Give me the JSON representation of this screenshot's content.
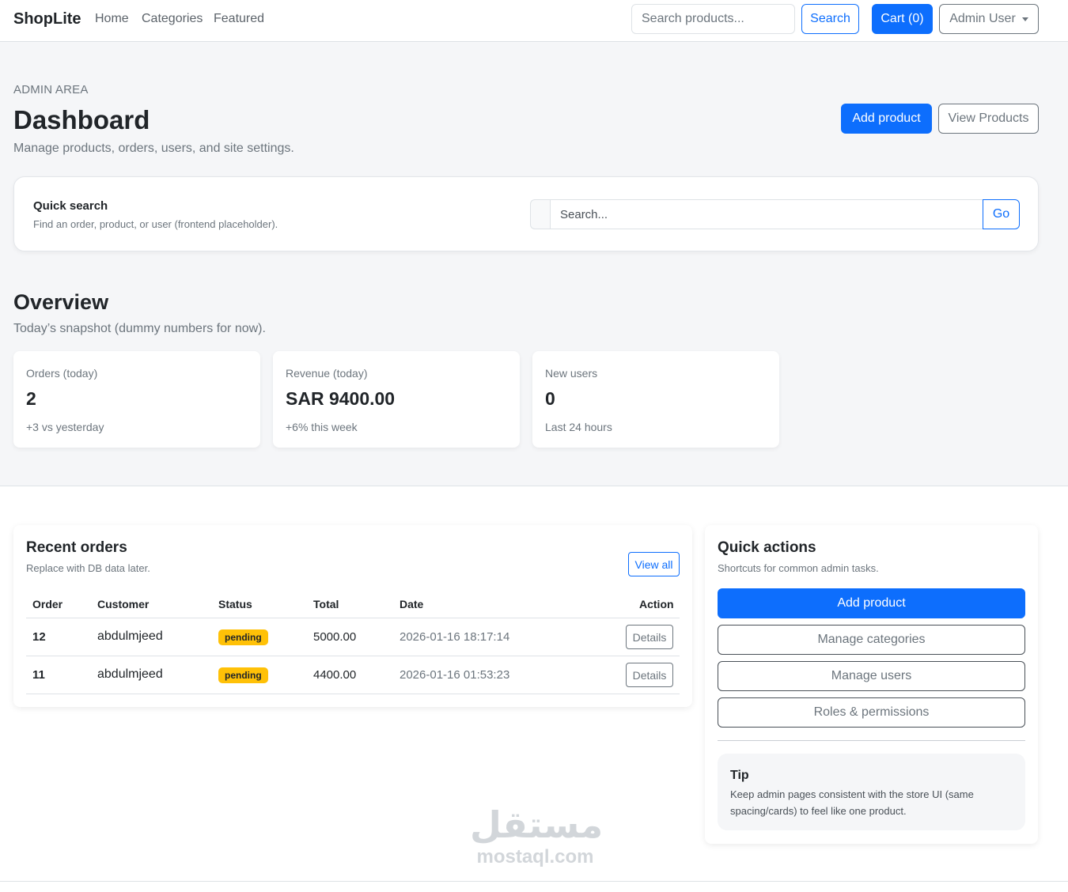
{
  "navbar": {
    "brand": "ShopLite",
    "links": [
      "Home",
      "Categories",
      "Featured"
    ],
    "search_placeholder": "Search products...",
    "search_button": "Search",
    "cart_label": "Cart (0)",
    "user_label": "Admin User"
  },
  "header": {
    "eyebrow": "ADMIN AREA",
    "title": "Dashboard",
    "subtitle": "Manage products, orders, users, and site settings.",
    "add_product": "Add product",
    "view_products": "View Products"
  },
  "quick_search": {
    "title": "Quick search",
    "subtitle": "Find an order, product, or user (frontend placeholder).",
    "placeholder": "Search...",
    "go": "Go"
  },
  "overview": {
    "title": "Overview",
    "subtitle": "Today’s snapshot (dummy numbers for now).",
    "stats": [
      {
        "label": "Orders (today)",
        "value": "2",
        "note": "+3 vs yesterday"
      },
      {
        "label": "Revenue (today)",
        "value": "SAR 9400.00",
        "note": "+6% this week"
      },
      {
        "label": "New users",
        "value": "0",
        "note": "Last 24 hours"
      }
    ]
  },
  "recent_orders": {
    "title": "Recent orders",
    "subtitle": "Replace with DB data later.",
    "view_all": "View all",
    "columns": [
      "Order",
      "Customer",
      "Status",
      "Total",
      "Date",
      "Action"
    ],
    "rows": [
      {
        "order": "12",
        "customer": "abdulmjeed",
        "status": "pending",
        "total": "5000.00",
        "date": "2026-01-16 18:17:14",
        "action": "Details"
      },
      {
        "order": "11",
        "customer": "abdulmjeed",
        "status": "pending",
        "total": "4400.00",
        "date": "2026-01-16 01:53:23",
        "action": "Details"
      }
    ]
  },
  "quick_actions": {
    "title": "Quick actions",
    "subtitle": "Shortcuts for common admin tasks.",
    "buttons": [
      "Add product",
      "Manage categories",
      "Manage users",
      "Roles & permissions"
    ],
    "tip_title": "Tip",
    "tip_text": "Keep admin pages consistent with the store UI (same spacing/cards) to feel like one product."
  },
  "watermark": {
    "arabic": "مستقل",
    "latin": "mostaql.com"
  },
  "colors": {
    "primary": "#0d6efd",
    "secondary": "#6c757d",
    "warning": "#ffc107",
    "background": "#f5f6f8"
  }
}
